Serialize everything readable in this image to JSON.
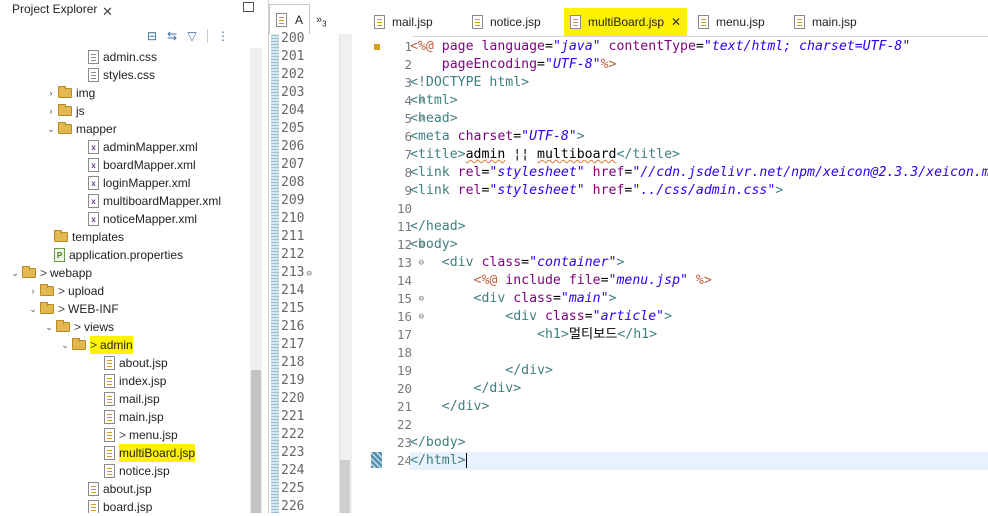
{
  "explorer": {
    "title": "Project Explorer",
    "close_glyph": "✕",
    "toolbar": [
      {
        "icon": "collapse-all-icon",
        "glyph": "⊟"
      },
      {
        "icon": "link-with-editor-icon",
        "glyph": "⇆"
      },
      {
        "icon": "filter-icon",
        "glyph": "▽"
      },
      {
        "icon": "view-menu-icon",
        "glyph": "⋮"
      }
    ],
    "tree": [
      {
        "label": "admin.css",
        "indent": 104,
        "icon": "file",
        "twisty": "",
        "prefix": ""
      },
      {
        "label": "styles.css",
        "indent": 104,
        "icon": "file",
        "twisty": "",
        "prefix": ""
      },
      {
        "label": "img",
        "indent": 74,
        "icon": "folder",
        "twisty": "›",
        "prefix": ""
      },
      {
        "label": "js",
        "indent": 74,
        "icon": "folder",
        "twisty": "›",
        "prefix": ""
      },
      {
        "label": "mapper",
        "indent": 74,
        "icon": "folder",
        "twisty": "⌄",
        "prefix": ""
      },
      {
        "label": "adminMapper.xml",
        "indent": 104,
        "icon": "xml",
        "twisty": "",
        "prefix": ""
      },
      {
        "label": "boardMapper.xml",
        "indent": 104,
        "icon": "xml",
        "twisty": "",
        "prefix": ""
      },
      {
        "label": "loginMapper.xml",
        "indent": 104,
        "icon": "xml",
        "twisty": "",
        "prefix": ""
      },
      {
        "label": "multiboardMapper.xml",
        "indent": 104,
        "icon": "xml",
        "twisty": "",
        "prefix": ""
      },
      {
        "label": "noticeMapper.xml",
        "indent": 104,
        "icon": "xml",
        "twisty": "",
        "prefix": ""
      },
      {
        "label": "templates",
        "indent": 70,
        "icon": "folder",
        "twisty": "",
        "prefix": ""
      },
      {
        "label": "application.properties",
        "indent": 70,
        "icon": "props",
        "twisty": "",
        "prefix": ""
      },
      {
        "label": "webapp",
        "indent": 38,
        "icon": "folder",
        "twisty": "⌄",
        "prefix": ">"
      },
      {
        "label": "upload",
        "indent": 56,
        "icon": "folder",
        "twisty": "›",
        "prefix": ">"
      },
      {
        "label": "WEB-INF",
        "indent": 56,
        "icon": "folder",
        "twisty": "⌄",
        "prefix": ">"
      },
      {
        "label": "views",
        "indent": 72,
        "icon": "folder",
        "twisty": "⌄",
        "prefix": ">"
      },
      {
        "label": "admin",
        "indent": 88,
        "icon": "folder",
        "twisty": "⌄",
        "prefix": ">",
        "highlight": true
      },
      {
        "label": "about.jsp",
        "indent": 120,
        "icon": "jsp",
        "twisty": "",
        "prefix": ""
      },
      {
        "label": "index.jsp",
        "indent": 120,
        "icon": "jsp",
        "twisty": "",
        "prefix": ""
      },
      {
        "label": "mail.jsp",
        "indent": 120,
        "icon": "jsp",
        "twisty": "",
        "prefix": ""
      },
      {
        "label": "main.jsp",
        "indent": 120,
        "icon": "jsp",
        "twisty": "",
        "prefix": ""
      },
      {
        "label": "menu.jsp",
        "indent": 120,
        "icon": "jsp",
        "twisty": "",
        "prefix": ">"
      },
      {
        "label": "multiBoard.jsp",
        "indent": 120,
        "icon": "jsp",
        "twisty": "",
        "prefix": "",
        "highlight": true
      },
      {
        "label": "notice.jsp",
        "indent": 120,
        "icon": "jsp",
        "twisty": "",
        "prefix": ""
      },
      {
        "label": "about.jsp",
        "indent": 104,
        "icon": "jsp",
        "twisty": "",
        "prefix": ""
      },
      {
        "label": "board.jsp",
        "indent": 104,
        "icon": "jsp",
        "twisty": "",
        "prefix": ""
      }
    ]
  },
  "outline": {
    "tab_label": "A",
    "more_label": "»",
    "more_count": "3",
    "lines": [
      "200",
      "201",
      "202",
      "203",
      "204",
      "205",
      "206",
      "207",
      "208",
      "209",
      "210",
      "211",
      "212",
      "213",
      "214",
      "215",
      "216",
      "217",
      "218",
      "219",
      "220",
      "221",
      "222",
      "223",
      "224",
      "225",
      "226"
    ],
    "folded": [
      "213"
    ]
  },
  "editor": {
    "tabs": [
      {
        "label": "mail.jsp",
        "active": false
      },
      {
        "label": "notice.jsp",
        "active": false
      },
      {
        "label": "multiBoard.jsp",
        "active": true
      },
      {
        "label": "menu.jsp",
        "active": false
      },
      {
        "label": "main.jsp",
        "active": false
      }
    ],
    "close_glyph": "✕",
    "current_line": 24,
    "lines": [
      {
        "n": "1",
        "fold": "",
        "tokens": [
          [
            "dir",
            "<%@ "
          ],
          [
            "attr",
            "page "
          ],
          [
            "attr",
            "language"
          ],
          [
            "txt",
            "="
          ],
          [
            "val",
            "\"java\""
          ],
          [
            "txt",
            " "
          ],
          [
            "attr",
            "contentType"
          ],
          [
            "txt",
            "="
          ],
          [
            "val",
            "\"text/html; charset=UTF-8\""
          ]
        ]
      },
      {
        "n": "2",
        "fold": "",
        "tokens": [
          [
            "txt",
            "    "
          ],
          [
            "attr",
            "pageEncoding"
          ],
          [
            "txt",
            "="
          ],
          [
            "val",
            "\"UTF-8\""
          ],
          [
            "dir",
            "%>"
          ]
        ]
      },
      {
        "n": "3",
        "fold": "",
        "tokens": [
          [
            "tag",
            "<!DOCTYPE html>"
          ]
        ]
      },
      {
        "n": "4",
        "fold": "⊖",
        "tokens": [
          [
            "tag",
            "<html>"
          ]
        ]
      },
      {
        "n": "5",
        "fold": "⊖",
        "tokens": [
          [
            "tag",
            "<head>"
          ]
        ]
      },
      {
        "n": "6",
        "fold": "",
        "tokens": [
          [
            "tag",
            "<meta "
          ],
          [
            "attr",
            "charset"
          ],
          [
            "txt",
            "="
          ],
          [
            "val",
            "\"UTF-8\""
          ],
          [
            "tag",
            ">"
          ]
        ]
      },
      {
        "n": "7",
        "fold": "",
        "tokens": [
          [
            "tag",
            "<title>"
          ],
          [
            "sq",
            "admin"
          ],
          [
            "txt",
            " ¦¦ "
          ],
          [
            "sq",
            "multiboard"
          ],
          [
            "tag",
            "</title>"
          ]
        ]
      },
      {
        "n": "8",
        "fold": "",
        "tokens": [
          [
            "tag",
            "<link "
          ],
          [
            "attr",
            "rel"
          ],
          [
            "txt",
            "="
          ],
          [
            "val",
            "\"stylesheet\""
          ],
          [
            "txt",
            " "
          ],
          [
            "attr",
            "href"
          ],
          [
            "txt",
            "="
          ],
          [
            "val",
            "\"//cdn.jsdelivr.net/npm/xeicon@2.3.3/xeicon.min.css\""
          ],
          [
            "tag",
            ">"
          ]
        ]
      },
      {
        "n": "9",
        "fold": "",
        "tokens": [
          [
            "tag",
            "<link "
          ],
          [
            "attr",
            "rel"
          ],
          [
            "txt",
            "="
          ],
          [
            "val",
            "\"stylesheet\""
          ],
          [
            "txt",
            " "
          ],
          [
            "attr",
            "href"
          ],
          [
            "txt",
            "="
          ],
          [
            "val",
            "\"../css/admin.css\""
          ],
          [
            "tag",
            ">"
          ]
        ]
      },
      {
        "n": "10",
        "fold": "",
        "tokens": []
      },
      {
        "n": "11",
        "fold": "",
        "tokens": [
          [
            "tag",
            "</head>"
          ]
        ]
      },
      {
        "n": "12",
        "fold": "⊖",
        "tokens": [
          [
            "tag",
            "<body>"
          ]
        ]
      },
      {
        "n": "13",
        "fold": "⊖",
        "tokens": [
          [
            "txt",
            "    "
          ],
          [
            "tag",
            "<div "
          ],
          [
            "attr",
            "class"
          ],
          [
            "txt",
            "="
          ],
          [
            "val",
            "\"container\""
          ],
          [
            "tag",
            ">"
          ]
        ]
      },
      {
        "n": "14",
        "fold": "",
        "tokens": [
          [
            "txt",
            "        "
          ],
          [
            "dir",
            "<%@ "
          ],
          [
            "attr",
            "include "
          ],
          [
            "attr",
            "file"
          ],
          [
            "txt",
            "="
          ],
          [
            "val",
            "\"menu.jsp\""
          ],
          [
            "txt",
            " "
          ],
          [
            "dir",
            "%>"
          ]
        ]
      },
      {
        "n": "15",
        "fold": "⊖",
        "tokens": [
          [
            "txt",
            "        "
          ],
          [
            "tag",
            "<div "
          ],
          [
            "attr",
            "class"
          ],
          [
            "txt",
            "="
          ],
          [
            "val",
            "\"main\""
          ],
          [
            "tag",
            ">"
          ]
        ]
      },
      {
        "n": "16",
        "fold": "⊖",
        "tokens": [
          [
            "txt",
            "            "
          ],
          [
            "tag",
            "<div "
          ],
          [
            "attr",
            "class"
          ],
          [
            "txt",
            "="
          ],
          [
            "val",
            "\"article\""
          ],
          [
            "tag",
            ">"
          ]
        ]
      },
      {
        "n": "17",
        "fold": "",
        "tokens": [
          [
            "txt",
            "                "
          ],
          [
            "tag",
            "<h1>"
          ],
          [
            "txt",
            "멀티보드"
          ],
          [
            "tag",
            "</h1>"
          ]
        ]
      },
      {
        "n": "18",
        "fold": "",
        "tokens": []
      },
      {
        "n": "19",
        "fold": "",
        "tokens": [
          [
            "txt",
            "            "
          ],
          [
            "tag",
            "</div>"
          ]
        ]
      },
      {
        "n": "20",
        "fold": "",
        "tokens": [
          [
            "txt",
            "        "
          ],
          [
            "tag",
            "</div>"
          ]
        ]
      },
      {
        "n": "21",
        "fold": "",
        "tokens": [
          [
            "txt",
            "    "
          ],
          [
            "tag",
            "</div>"
          ]
        ]
      },
      {
        "n": "22",
        "fold": "",
        "tokens": []
      },
      {
        "n": "23",
        "fold": "",
        "tokens": [
          [
            "tag",
            "</body>"
          ]
        ]
      },
      {
        "n": "24",
        "fold": "",
        "tokens": [
          [
            "tag",
            "</html>"
          ]
        ]
      }
    ]
  },
  "colors": {
    "highlight": "#fff200",
    "tag": "#3f7f7f",
    "attribute": "#7f007f",
    "value": "#2a00ff",
    "directive": "#bf5f3f",
    "current_line": "#e8f2fe"
  }
}
